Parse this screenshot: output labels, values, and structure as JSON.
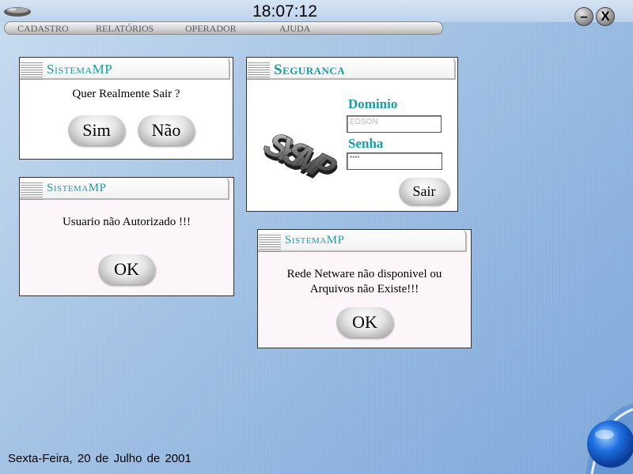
{
  "clock": "18:07:12",
  "menu": [
    "CADASTRO",
    "RELATÓRIOS",
    "OPERADOR",
    "AJUDA"
  ],
  "window_buttons": {
    "minimize": "–",
    "close": "X"
  },
  "dialog_exit": {
    "title": "SistemaMP",
    "message": "Quer Realmente Sair ?",
    "yes_label": "Sim",
    "no_label": "Não"
  },
  "dialog_security": {
    "title": "Seguranca",
    "logo_text": "SYSMP",
    "domain_label": "Dominio",
    "domain_value": "EDSON",
    "password_label": "Senha",
    "password_value": "****",
    "exit_label": "Sair"
  },
  "dialog_unauthorized": {
    "title": "SistemaMP",
    "message": "Usuario não Autorizado !!!",
    "ok_label": "OK"
  },
  "dialog_network": {
    "title": "SistemaMP",
    "message_line1": "Rede Netware não disponivel ou",
    "message_line2": "Arquivos não Existe!!!",
    "ok_label": "OK"
  },
  "status_bar": {
    "date": "Sexta-Feira, 20 de Julho de 2001"
  }
}
